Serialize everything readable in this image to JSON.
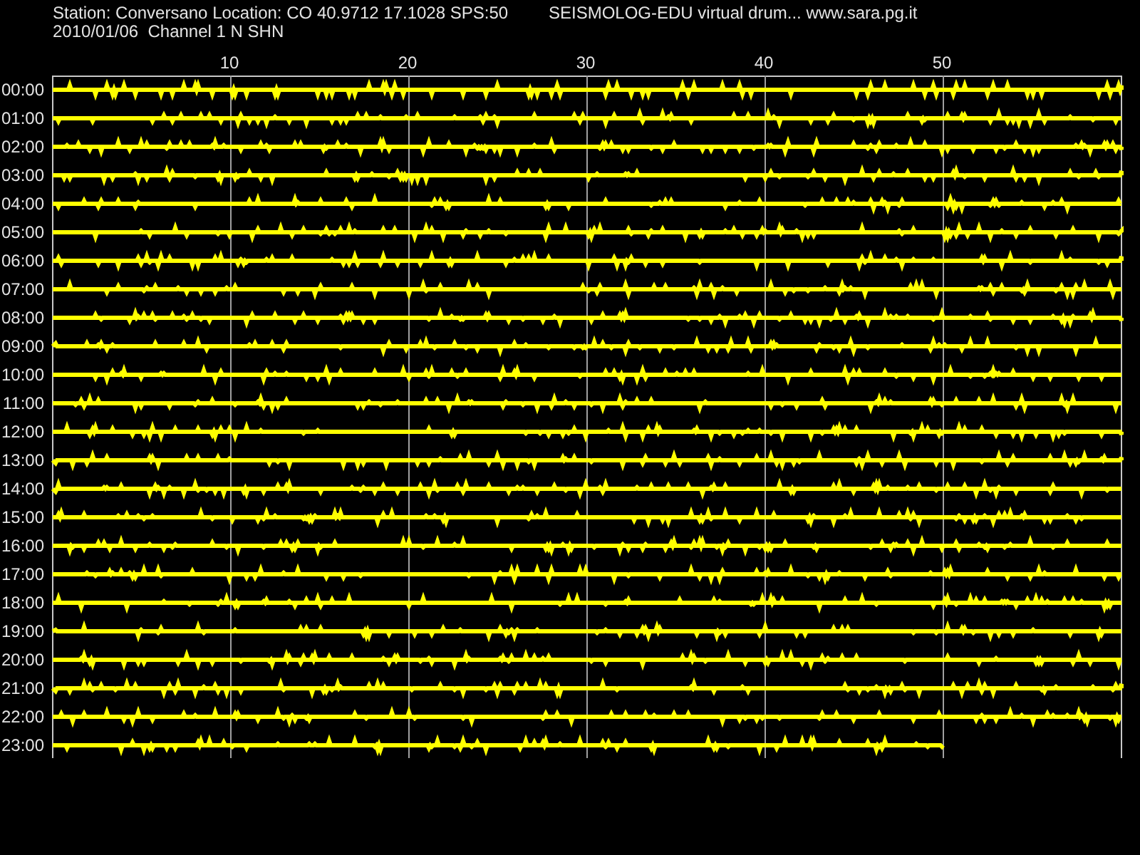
{
  "header": {
    "station_line": "Station: Conversano Location: CO 40.9712 17.1028 SPS:50",
    "title": "SEISMOLOG-EDU virtual drum... www.sara.pg.it",
    "date_line": "2010/01/06  Channel 1 N SHN"
  },
  "drum": {
    "minute_ticks": [
      "10",
      "20",
      "30",
      "40",
      "50"
    ],
    "rows": [
      {
        "label": "00:00",
        "level": 1
      },
      {
        "label": "01:00",
        "level": 1
      },
      {
        "label": "02:00",
        "level": 1
      },
      {
        "label": "03:00",
        "level": 1
      },
      {
        "label": "04:00",
        "level": 1
      },
      {
        "label": "05:00",
        "level": 1
      },
      {
        "label": "06:00",
        "level": 1
      },
      {
        "label": "07:00",
        "level": 1
      },
      {
        "label": "08:00",
        "level": 1
      },
      {
        "label": "09:00",
        "level": 1
      },
      {
        "label": "10:00",
        "level": 1
      },
      {
        "label": "11:00",
        "level": 1
      },
      {
        "label": "12:00",
        "level": 1
      },
      {
        "label": "13:00",
        "level": 1
      },
      {
        "label": "14:00",
        "level": 1
      },
      {
        "label": "15:00",
        "level": 1
      },
      {
        "label": "16:00",
        "level": 1
      },
      {
        "label": "17:00",
        "level": 1
      },
      {
        "label": "18:00",
        "level": 1
      },
      {
        "label": "19:00",
        "level": 1
      },
      {
        "label": "20:00",
        "level": 1
      },
      {
        "label": "21:00",
        "level": 1
      },
      {
        "label": "22:00",
        "level": 1
      },
      {
        "label": "23:00",
        "level": 0.833
      }
    ]
  }
}
